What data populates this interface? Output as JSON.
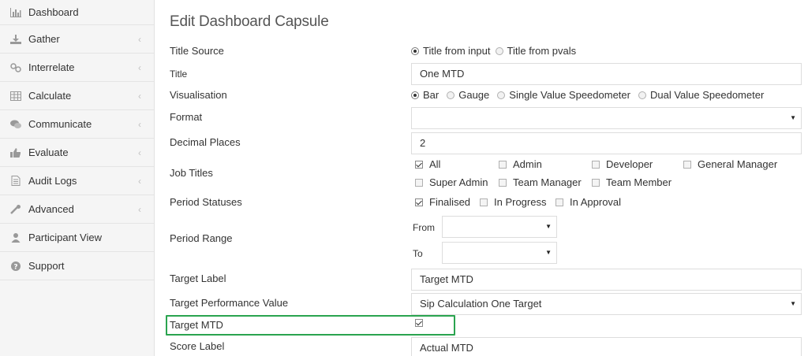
{
  "sidebar": {
    "items": [
      {
        "label": "Dashboard",
        "icon": "bar-chart-icon",
        "chevron": false
      },
      {
        "label": "Gather",
        "icon": "download-icon",
        "chevron": true
      },
      {
        "label": "Interrelate",
        "icon": "link-icon",
        "chevron": true
      },
      {
        "label": "Calculate",
        "icon": "table-icon",
        "chevron": true
      },
      {
        "label": "Communicate",
        "icon": "comments-icon",
        "chevron": true
      },
      {
        "label": "Evaluate",
        "icon": "thumbs-up-icon",
        "chevron": true
      },
      {
        "label": "Audit Logs",
        "icon": "document-icon",
        "chevron": true
      },
      {
        "label": "Advanced",
        "icon": "wrench-icon",
        "chevron": true
      },
      {
        "label": "Participant View",
        "icon": "user-icon",
        "chevron": false
      },
      {
        "label": "Support",
        "icon": "question-circle-icon",
        "chevron": false
      }
    ],
    "chevron_glyph": "‹"
  },
  "page": {
    "title": "Edit Dashboard Capsule"
  },
  "form": {
    "title_source": {
      "label": "Title Source",
      "options": [
        "Title from input",
        "Title from pvals"
      ],
      "selected": 0
    },
    "title": {
      "label": "Title",
      "value": "One MTD"
    },
    "visualisation": {
      "label": "Visualisation",
      "options": [
        "Bar",
        "Gauge",
        "Single Value Speedometer",
        "Dual Value Speedometer"
      ],
      "selected": 0
    },
    "format": {
      "label": "Format",
      "value": ""
    },
    "decimal_places": {
      "label": "Decimal Places",
      "value": "2"
    },
    "job_titles": {
      "label": "Job Titles",
      "options": [
        {
          "label": "All",
          "checked": true
        },
        {
          "label": "Admin",
          "checked": false
        },
        {
          "label": "Developer",
          "checked": false
        },
        {
          "label": "General Manager",
          "checked": false
        },
        {
          "label": "Super Admin",
          "checked": false
        },
        {
          "label": "Team Manager",
          "checked": false
        },
        {
          "label": "Team Member",
          "checked": false
        }
      ]
    },
    "period_statuses": {
      "label": "Period Statuses",
      "options": [
        {
          "label": "Finalised",
          "checked": true
        },
        {
          "label": "In Progress",
          "checked": false
        },
        {
          "label": "In Approval",
          "checked": false
        }
      ]
    },
    "period_range": {
      "label": "Period Range",
      "from_label": "From",
      "to_label": "To",
      "from_value": "",
      "to_value": ""
    },
    "target_label": {
      "label": "Target Label",
      "value": "Target MTD"
    },
    "target_performance_value": {
      "label": "Target Performance Value",
      "value": "Sip Calculation One Target"
    },
    "target_mtd": {
      "label": "Target MTD",
      "checked": true
    },
    "score_label": {
      "label": "Score Label",
      "value": "Actual MTD"
    }
  },
  "colors": {
    "highlight": "#2aa44f",
    "sidebar_bg": "#f5f5f5"
  },
  "caret_glyph": "▼"
}
